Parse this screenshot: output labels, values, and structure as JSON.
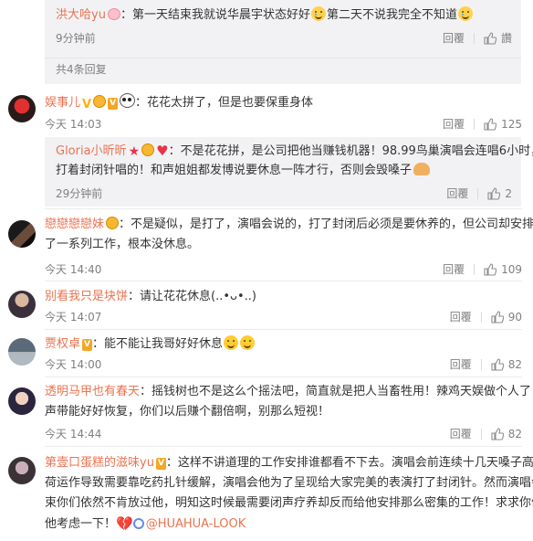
{
  "top_thread": {
    "reply": {
      "username": "洪大哈yu",
      "text_a": "：第一天结束我就说华晨宇状态好好",
      "text_b": "第二天不说我完全不知道",
      "time": "9分钟前",
      "reply_label": "回覆",
      "like_label": "讚"
    },
    "more_replies": "共4条回复"
  },
  "comments": [
    {
      "username": "娱事儿",
      "text": "：花花太拼了，但是也要保重身体",
      "time": "今天 14:03",
      "reply_label": "回覆",
      "likes": "125",
      "reply": {
        "username": "Gloria小昕昕",
        "text_a": "：不是花花拼，是公司把他当赚钱机器！98.99鸟巢演唱会连唱6小时，",
        "text_b": "打着封闭针唱的！和声姐姐都发博说要休息一阵才行，否则会毁嗓子",
        "time": "29分钟前",
        "reply_label": "回覆",
        "likes": "2"
      }
    },
    {
      "username": "戀戀戀戀妹",
      "text_a": "：不是疑似，是打了，演唱会说的，打了封闭后必须是要休养的，但公司却安排",
      "text_b": "了一系列工作，根本没休息。",
      "time": "今天 14:40",
      "reply_label": "回覆",
      "likes": "109"
    },
    {
      "username": "别看我只是块饼",
      "text": "：请让花花休息(..•ᴗ•..)",
      "time": "今天 14:07",
      "reply_label": "回覆",
      "likes": "90"
    },
    {
      "username": "贾权卓",
      "text": "：能不能让我哥好好休息",
      "time": "今天 14:00",
      "reply_label": "回覆",
      "likes": "82"
    },
    {
      "username": "透明马甲也有春天",
      "text_a": "：摇钱树也不是这么个摇法吧，简直就是把人当畜牲用！辣鸡天娱做个人了！他",
      "text_b": "声带能好好恢复，你们以后赚个翻倍啊，别那么短视！",
      "time": "今天 14:44",
      "reply_label": "回覆",
      "likes": "82"
    },
    {
      "username": "第壹口蛋糕的滋味yu",
      "text_a": "：这样不讲道理的工作安排谁都看不下去。演唱会前连续十几天嗓子高负",
      "text_b": "荷运作导致需要靠吃药扎针缓解，演唱会他为了呈现给大家完美的表演打了封闭针。然而演唱会结",
      "text_c": "束你们依然不肯放过他，明知这时候最需要闭声疗养却反而给他安排那么密集的工作！求求你们为",
      "text_d": "他考虑一下！",
      "link_text": "@HUAHUA-LOOK"
    }
  ],
  "colors": {
    "username": "#eb7350",
    "text": "#333333",
    "meta": "#808080",
    "nested_bg": "#f2f2f5",
    "like_icon": "#8c8c8c"
  },
  "icons": [
    "like-thumb-icon",
    "emoji-icon",
    "heart-icon",
    "star-icon",
    "vip-badge-icon",
    "broken-heart-icon",
    "link-icon"
  ]
}
